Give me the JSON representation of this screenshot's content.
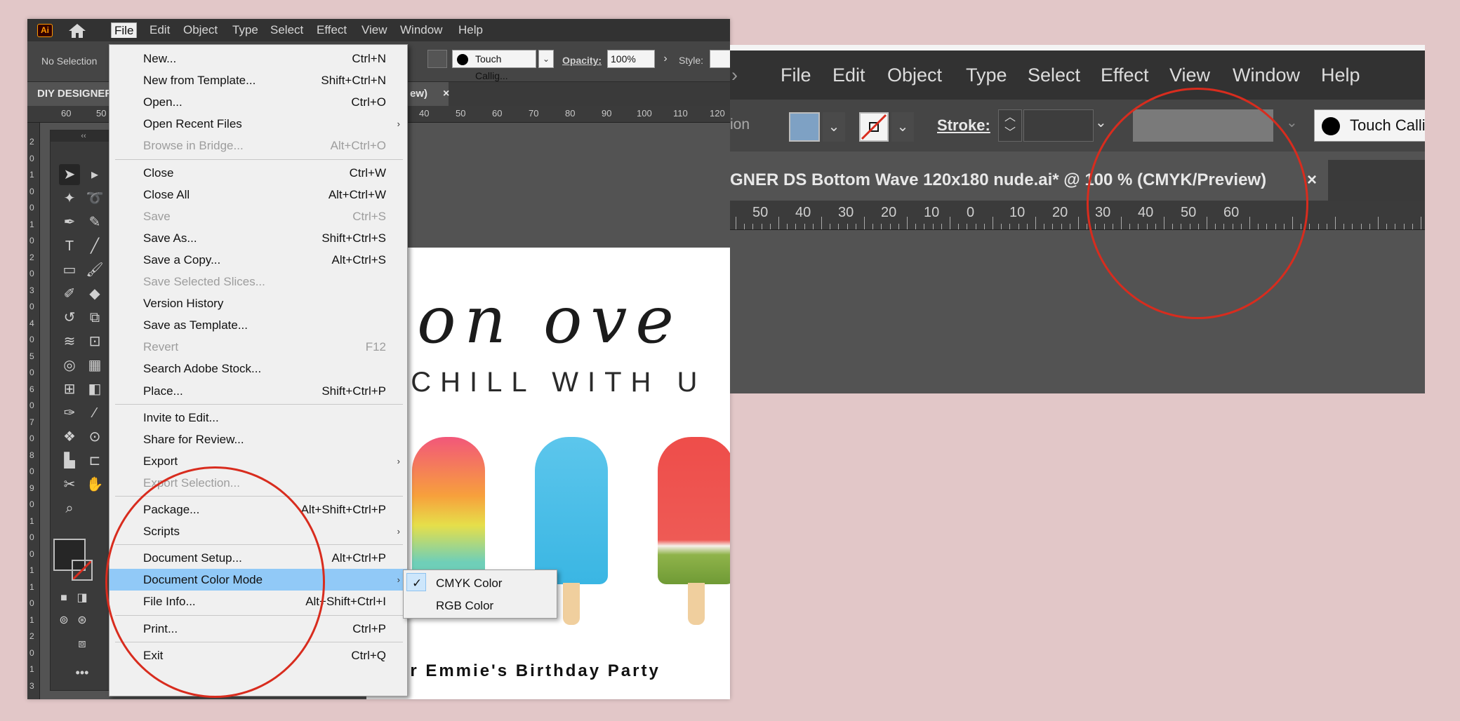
{
  "left_app": {
    "logo_text": "Ai",
    "menubar": [
      "File",
      "Edit",
      "Object",
      "Type",
      "Select",
      "Effect",
      "View",
      "Window",
      "Help"
    ],
    "control": {
      "selection": "No Selection",
      "brush": "Touch Callig...",
      "opacity_label": "Opacity:",
      "opacity_value": "100%",
      "style_label": "Style:"
    },
    "tab": {
      "title": "DIY DESIGNER",
      "suffix": "ew)",
      "close": "×"
    },
    "h_ruler": [
      "60",
      "50",
      "40",
      "50",
      "60",
      "70",
      "80",
      "90",
      "100",
      "110",
      "120"
    ],
    "v_ruler": [
      "2",
      "0",
      "1",
      "0",
      "0",
      "1",
      "0",
      "2",
      "0",
      "3",
      "0",
      "4",
      "0",
      "5",
      "0",
      "6",
      "0",
      "7",
      "0",
      "8",
      "0",
      "9",
      "0",
      "1",
      "0",
      "0",
      "1",
      "1",
      "0",
      "1",
      "2",
      "0",
      "1",
      "3"
    ],
    "file_menu": [
      {
        "label": "New...",
        "shortcut": "Ctrl+N"
      },
      {
        "label": "New from Template...",
        "shortcut": "Shift+Ctrl+N"
      },
      {
        "label": "Open...",
        "shortcut": "Ctrl+O"
      },
      {
        "label": "Open Recent Files",
        "submenu": true
      },
      {
        "label": "Browse in Bridge...",
        "shortcut": "Alt+Ctrl+O",
        "disabled": true
      },
      {
        "label": "Close",
        "shortcut": "Ctrl+W"
      },
      {
        "label": "Close All",
        "shortcut": "Alt+Ctrl+W"
      },
      {
        "label": "Save",
        "shortcut": "Ctrl+S",
        "disabled": true
      },
      {
        "label": "Save As...",
        "shortcut": "Shift+Ctrl+S"
      },
      {
        "label": "Save a Copy...",
        "shortcut": "Alt+Ctrl+S"
      },
      {
        "label": "Save Selected Slices...",
        "disabled": true
      },
      {
        "label": "Version History"
      },
      {
        "label": "Save as Template..."
      },
      {
        "label": "Revert",
        "shortcut": "F12",
        "disabled": true
      },
      {
        "label": "Search Adobe Stock..."
      },
      {
        "label": "Place...",
        "shortcut": "Shift+Ctrl+P"
      },
      {
        "label": "Invite to Edit..."
      },
      {
        "label": "Share for Review..."
      },
      {
        "label": "Export",
        "submenu": true
      },
      {
        "label": "Export Selection...",
        "disabled": true
      },
      {
        "label": "Package...",
        "shortcut": "Alt+Shift+Ctrl+P"
      },
      {
        "label": "Scripts",
        "submenu": true
      },
      {
        "label": "Document Setup...",
        "shortcut": "Alt+Ctrl+P"
      },
      {
        "label": "Document Color Mode",
        "submenu": true,
        "highlighted": true
      },
      {
        "label": "File Info...",
        "shortcut": "Alt+Shift+Ctrl+I"
      },
      {
        "label": "Print...",
        "shortcut": "Ctrl+P"
      },
      {
        "label": "Exit",
        "shortcut": "Ctrl+Q"
      }
    ],
    "color_mode_submenu": [
      {
        "label": "CMYK Color",
        "checked": true
      },
      {
        "label": "RGB Color",
        "checked": false
      }
    ],
    "artboard": {
      "headline": "p on ove",
      "subline": "O CHILL WITH U",
      "party_line": "us for Emmie's Birthday Party"
    }
  },
  "right_app": {
    "menubar": [
      "File",
      "Edit",
      "Object",
      "Type",
      "Select",
      "Effect",
      "View",
      "Window",
      "Help"
    ],
    "control": {
      "cut_label": "ion",
      "stroke_label": "Stroke:",
      "brush": "Touch Calli"
    },
    "tab": {
      "title": "GNER DS Bottom Wave 120x180 nude.ai* @ 100 % (CMYK/Preview)",
      "close": "×"
    },
    "ruler": [
      "50",
      "40",
      "30",
      "20",
      "10",
      "0",
      "10",
      "20",
      "30",
      "40",
      "50",
      "60"
    ]
  },
  "colors": {
    "background": "#e2c7c8",
    "annotation": "#d82c1e",
    "highlight": "#91c9f7",
    "fill_swatch": "#7ea1c4"
  }
}
